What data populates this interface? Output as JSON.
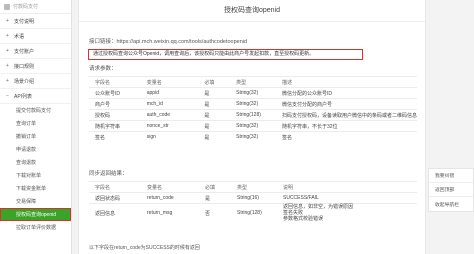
{
  "brand": {
    "title": "付款码支付"
  },
  "sidebar": {
    "items": [
      {
        "label": "支付说明",
        "expander": "+"
      },
      {
        "label": "术语",
        "expander": "+"
      },
      {
        "label": "支付账户",
        "expander": "+"
      },
      {
        "label": "接口规则",
        "expander": "+"
      },
      {
        "label": "场景介绍",
        "expander": "+"
      },
      {
        "label": "API列表",
        "expander": "−"
      }
    ],
    "api_subitems": [
      "提交付款码支付",
      "查询订单",
      "撤销订单",
      "申请退款",
      "查询退款",
      "下载对账单",
      "下载资金账单",
      "交易保障",
      "授权码查询openid",
      "拉取订单评价数据"
    ],
    "active_index": 8
  },
  "main": {
    "title": "授权码查询openid",
    "url_label": "接口链接：https://api.mch.weixin.qq.com/tools/authcodetoopenid",
    "notice": "通过授权码查询公众号Openid，调用查询后，该授权码只能由此商户号发起扣款，直至授权码更新。",
    "request_title": "请求参数：",
    "request_headers": [
      "字段名",
      "变量名",
      "必填",
      "类型",
      "描述"
    ],
    "request_rows": [
      [
        "公众账号ID",
        "appid",
        "是",
        "String(32)",
        "微信分配的公众账号ID"
      ],
      [
        "商户号",
        "mch_id",
        "是",
        "String(32)",
        "微信支付分配的商户号"
      ],
      [
        "授权码",
        "auth_code",
        "是",
        "String(128)",
        "扫码支付授权码，设备读取用户微信中的条码或者二维码信息"
      ],
      [
        "随机字符串",
        "nonce_str",
        "是",
        "String(32)",
        "随机字符串，不长于32位"
      ],
      [
        "签名",
        "sign",
        "是",
        "String(32)",
        "签名"
      ]
    ],
    "response_title": "同步返回结果：",
    "response_headers": [
      "字段名",
      "变量名",
      "必填",
      "类型",
      "说明"
    ],
    "response_rows": [
      [
        "返回状态码",
        "return_code",
        "是",
        "String(16)",
        "SUCCESS/FAIL"
      ],
      [
        "返回信息",
        "return_msg",
        "否",
        "String(128)",
        "返回信息，如非空，为错误原因",
        "签名失败",
        "参数格式校验错误"
      ]
    ],
    "footer": "以下字段在return_code为SUCCESS的时候有返回"
  },
  "toolbox": {
    "items": [
      "我要纠错",
      "返回顶部",
      "收起导航栏"
    ]
  }
}
